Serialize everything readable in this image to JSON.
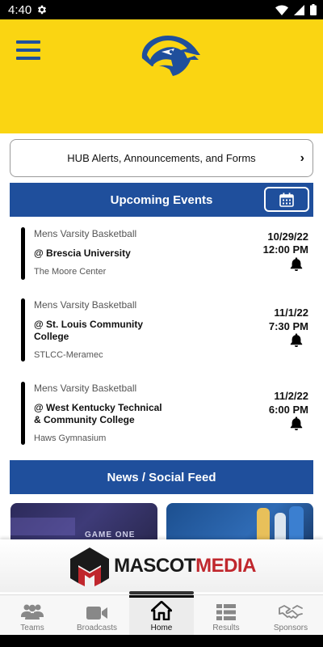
{
  "status_bar": {
    "time": "4:40",
    "icons": [
      "gear-icon",
      "wifi-icon",
      "signal-icon",
      "battery-icon"
    ]
  },
  "header": {
    "menu_icon": "hamburger-icon",
    "logo": "eagle-mascot-logo",
    "background": "#fad512",
    "accent": "#1f4f9c"
  },
  "hub": {
    "label": "HUB Alerts, Announcements, and Forms",
    "chevron": "›"
  },
  "upcoming": {
    "title": "Upcoming Events",
    "calendar_icon": "calendar-icon"
  },
  "events": [
    {
      "sport": "Mens Varsity Basketball",
      "opponent": "@ Brescia University",
      "venue": "The Moore Center",
      "date": "10/29/22",
      "time": "12:00 PM"
    },
    {
      "sport": "Mens Varsity Basketball",
      "opponent": "@ St. Louis Community College",
      "venue": "STLCC-Meramec",
      "date": "11/1/22",
      "time": "7:30 PM"
    },
    {
      "sport": "Mens Varsity Basketball",
      "opponent": "@ West Kentucky Technical & Community College",
      "venue": "Haws Gymnasium",
      "date": "11/2/22",
      "time": "6:00 PM"
    }
  ],
  "news": {
    "title": "News / Social Feed",
    "cards": [
      {
        "overlay_text": "GAME ONE"
      },
      {
        "overlay_text": ""
      }
    ]
  },
  "sponsor": {
    "name_part1": "MASCOT",
    "name_part2": "MEDIA"
  },
  "nav": {
    "items": [
      {
        "label": "Teams",
        "icon": "teams-icon"
      },
      {
        "label": "Broadcasts",
        "icon": "video-camera-icon"
      },
      {
        "label": "Home",
        "icon": "home-icon"
      },
      {
        "label": "Results",
        "icon": "results-list-icon"
      },
      {
        "label": "Sponsors",
        "icon": "handshake-icon"
      }
    ],
    "active": "Home"
  }
}
